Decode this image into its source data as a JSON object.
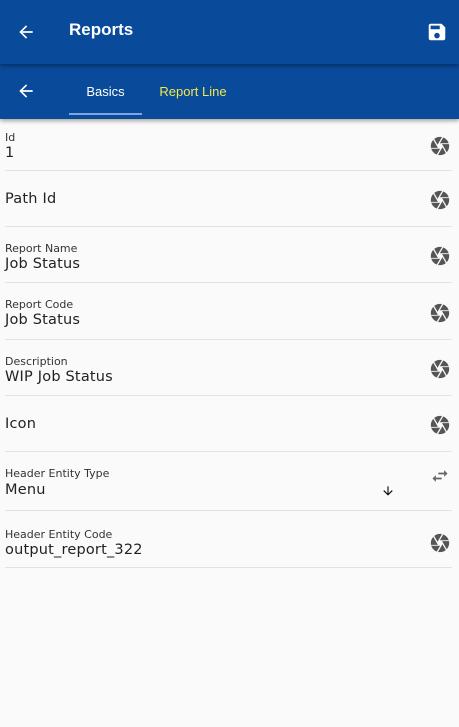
{
  "app_bar": {
    "title": "Reports",
    "back_icon": "arrow-left-icon",
    "save_icon": "save-icon"
  },
  "tabs": [
    {
      "label": "Basics",
      "active": true
    },
    {
      "label": "Report Line",
      "active": false
    }
  ],
  "colors": {
    "primary": "#0a4a9a",
    "active_tab_text": "#ffffff",
    "inactive_tab_text": "#f0e94a"
  },
  "fields": [
    {
      "label": "Id",
      "value": "1"
    },
    {
      "label": "Path Id",
      "value": ""
    },
    {
      "label": "Report Name",
      "value": "Job Status"
    },
    {
      "label": "Report Code",
      "value": "Job Status"
    },
    {
      "label": "Description",
      "value": "WIP Job Status"
    },
    {
      "label": "Icon",
      "value": ""
    },
    {
      "label": "Header Entity Type",
      "value": "Menu"
    },
    {
      "label": "Header Entity Code",
      "value": "output_report_322"
    }
  ],
  "icons": {
    "field_action": "aperture-icon",
    "swap": "swap-icon",
    "dropdown": "arrow-down-icon"
  }
}
